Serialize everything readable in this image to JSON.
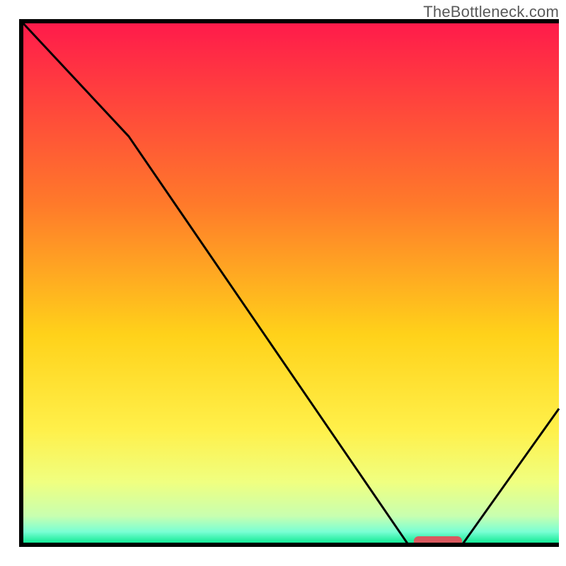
{
  "watermark": "TheBottleneck.com",
  "chart_data": {
    "type": "line",
    "title": "",
    "xlabel": "",
    "ylabel": "",
    "xlim": [
      0,
      100
    ],
    "ylim": [
      0,
      100
    ],
    "x": [
      0,
      20,
      72,
      82,
      100
    ],
    "values": [
      100,
      78,
      0,
      0,
      26
    ],
    "marker": {
      "x_start": 73,
      "x_end": 82,
      "y": 0,
      "color": "#d9595f"
    },
    "gradient_stops": [
      {
        "offset": 0.0,
        "color": "#ff1a4b"
      },
      {
        "offset": 0.35,
        "color": "#ff7a2a"
      },
      {
        "offset": 0.6,
        "color": "#ffd21a"
      },
      {
        "offset": 0.78,
        "color": "#fff04a"
      },
      {
        "offset": 0.88,
        "color": "#f0ff80"
      },
      {
        "offset": 0.945,
        "color": "#c8ffb0"
      },
      {
        "offset": 0.975,
        "color": "#7affd4"
      },
      {
        "offset": 1.0,
        "color": "#00e68a"
      }
    ],
    "axis_color": "#000000",
    "line_color": "#000000"
  }
}
